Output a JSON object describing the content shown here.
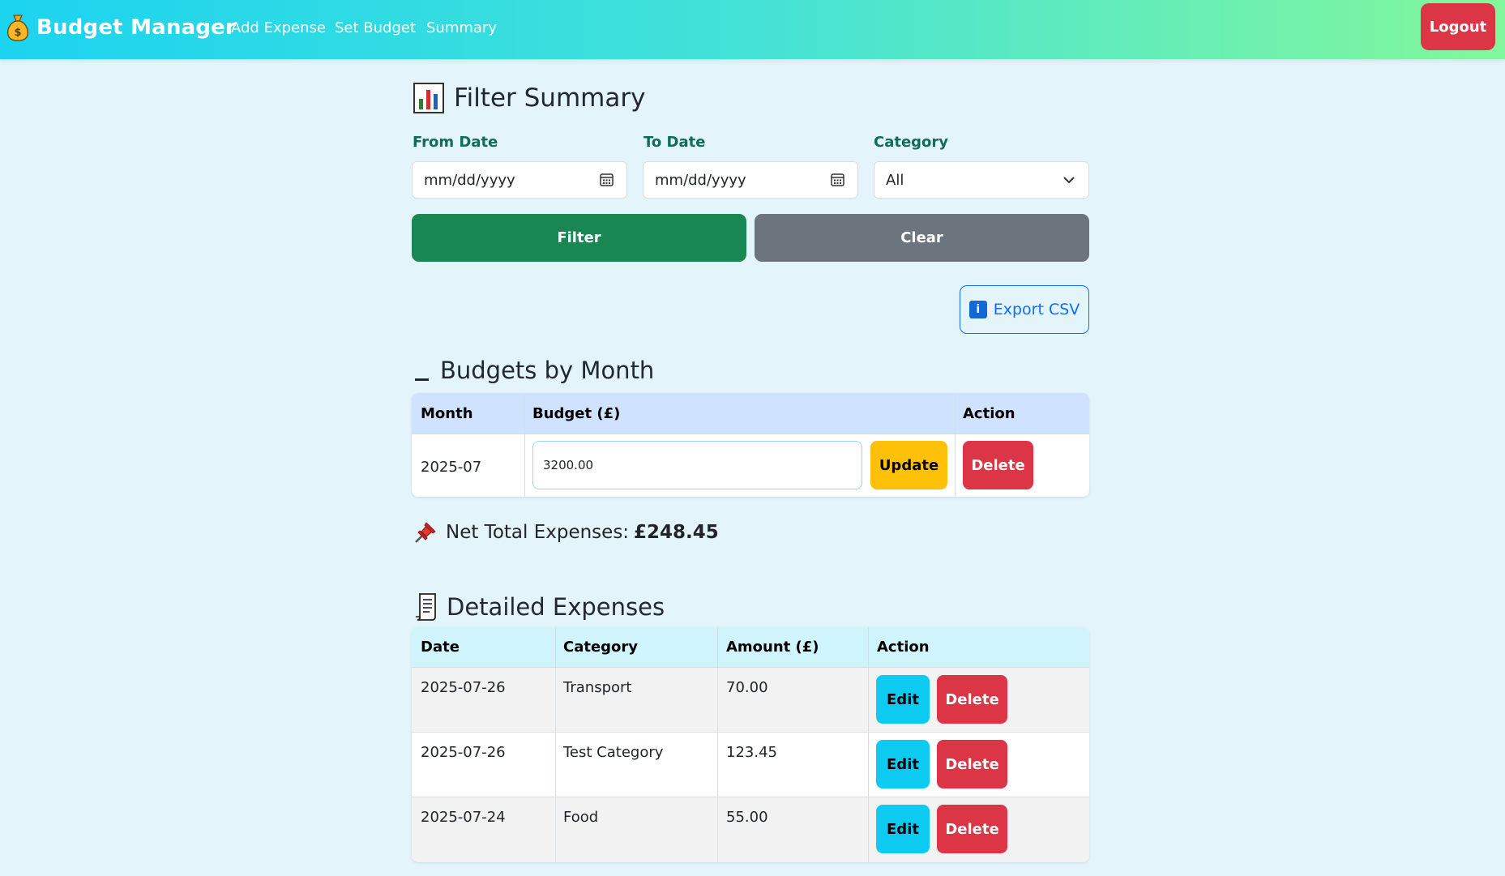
{
  "nav": {
    "brand": "Budget Manager",
    "links": [
      "Add Expense",
      "Set Budget",
      "Summary"
    ],
    "logout": "Logout"
  },
  "filter": {
    "title": "Filter Summary",
    "from_label": "From Date",
    "from_placeholder": "mm/dd/yyyy",
    "to_label": "To Date",
    "to_placeholder": "mm/dd/yyyy",
    "category_label": "Category",
    "category_value": "All",
    "filter_button": "Filter",
    "clear_button": "Clear",
    "export_button": "Export CSV"
  },
  "budgets": {
    "title": "Budgets by Month",
    "headers": [
      "Month",
      "Budget (£)",
      "Action"
    ],
    "rows": [
      {
        "month": "2025-07",
        "budget": "3200.00",
        "update": "Update",
        "delete": "Delete"
      }
    ]
  },
  "net_total": {
    "label": "Net Total Expenses:",
    "value": "£248.45"
  },
  "expenses": {
    "title": "Detailed Expenses",
    "headers": [
      "Date",
      "Category",
      "Amount (£)",
      "Action"
    ],
    "rows": [
      {
        "date": "2025-07-26",
        "category": "Transport",
        "amount": "70.00",
        "edit": "Edit",
        "delete": "Delete"
      },
      {
        "date": "2025-07-26",
        "category": "Test Category",
        "amount": "123.45",
        "edit": "Edit",
        "delete": "Delete"
      },
      {
        "date": "2025-07-24",
        "category": "Food",
        "amount": "55.00",
        "edit": "Edit",
        "delete": "Delete"
      }
    ]
  },
  "colors": {
    "page_background": "#e3f4fb",
    "nav_gradient_start": "#1cd3f0",
    "nav_gradient_end": "#83f79b",
    "primary_green": "#198754",
    "secondary_gray": "#6c757d",
    "danger_red": "#dc3545",
    "warning_yellow": "#ffc107",
    "info_cyan": "#0dcaf0",
    "label_teal": "#0f6b5a"
  },
  "icons": [
    "money-bag-icon",
    "bar-chart-icon",
    "calendar-icon",
    "chevron-down-icon",
    "info-icon",
    "pushpin-icon",
    "scroll-icon"
  ]
}
